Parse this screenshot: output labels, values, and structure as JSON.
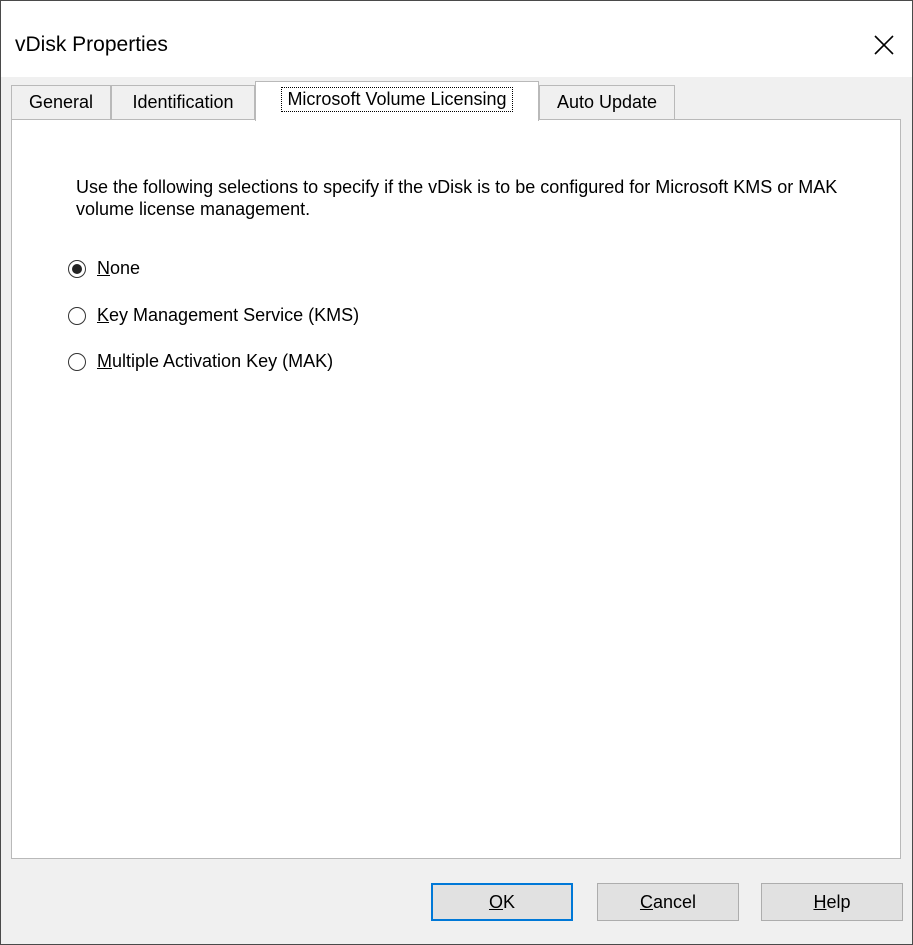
{
  "window": {
    "title": "vDisk Properties",
    "close_icon": "close-icon"
  },
  "tabs": [
    {
      "label": "General",
      "active": false
    },
    {
      "label": "Identification",
      "active": false
    },
    {
      "label": "Microsoft Volume Licensing",
      "active": true
    },
    {
      "label": "Auto Update",
      "active": false
    }
  ],
  "panel": {
    "description": "Use the following selections to specify if the vDisk is to be configured for Microsoft KMS or MAK volume license management.",
    "options": [
      {
        "mnemonic": "N",
        "rest": "one",
        "selected": true
      },
      {
        "mnemonic": "K",
        "rest": "ey Management Service (KMS)",
        "selected": false
      },
      {
        "mnemonic": "M",
        "rest": "ultiple Activation Key (MAK)",
        "selected": false
      }
    ]
  },
  "buttons": {
    "ok": {
      "mnemonic": "O",
      "rest": "K"
    },
    "cancel": {
      "mnemonic": "C",
      "rest": "ancel"
    },
    "help": {
      "mnemonic": "H",
      "rest": "elp"
    }
  },
  "colors": {
    "default_button_border": "#0078d7",
    "dialog_background": "#f0f0f0",
    "panel_background": "#ffffff"
  }
}
